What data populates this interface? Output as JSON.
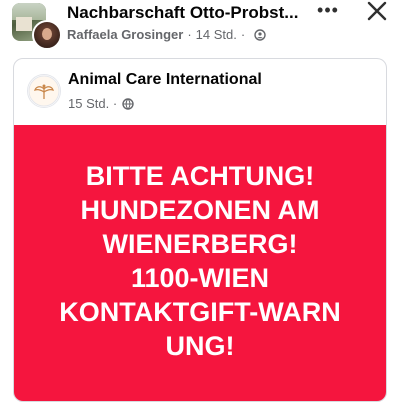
{
  "header": {
    "group_title": "Nachbarschaft Otto-Probst...",
    "author": "Raffaela Grosinger",
    "time": "14 Std.",
    "separator": "·",
    "privacy_icon": "group-privacy-icon",
    "more_label": "•••",
    "close_icon": "close-icon"
  },
  "shared_post": {
    "page_name": "Animal Care International",
    "time": "15 Std.",
    "separator": "·",
    "audience_icon": "globe-icon",
    "background_color": "#f5153e",
    "text_lines": [
      "BITTE ACHTUNG!",
      "HUNDEZONEN AM",
      "WIENERBERG!",
      "1100-WIEN",
      "KONTAKTGIFT-WARN",
      "UNG!"
    ]
  }
}
